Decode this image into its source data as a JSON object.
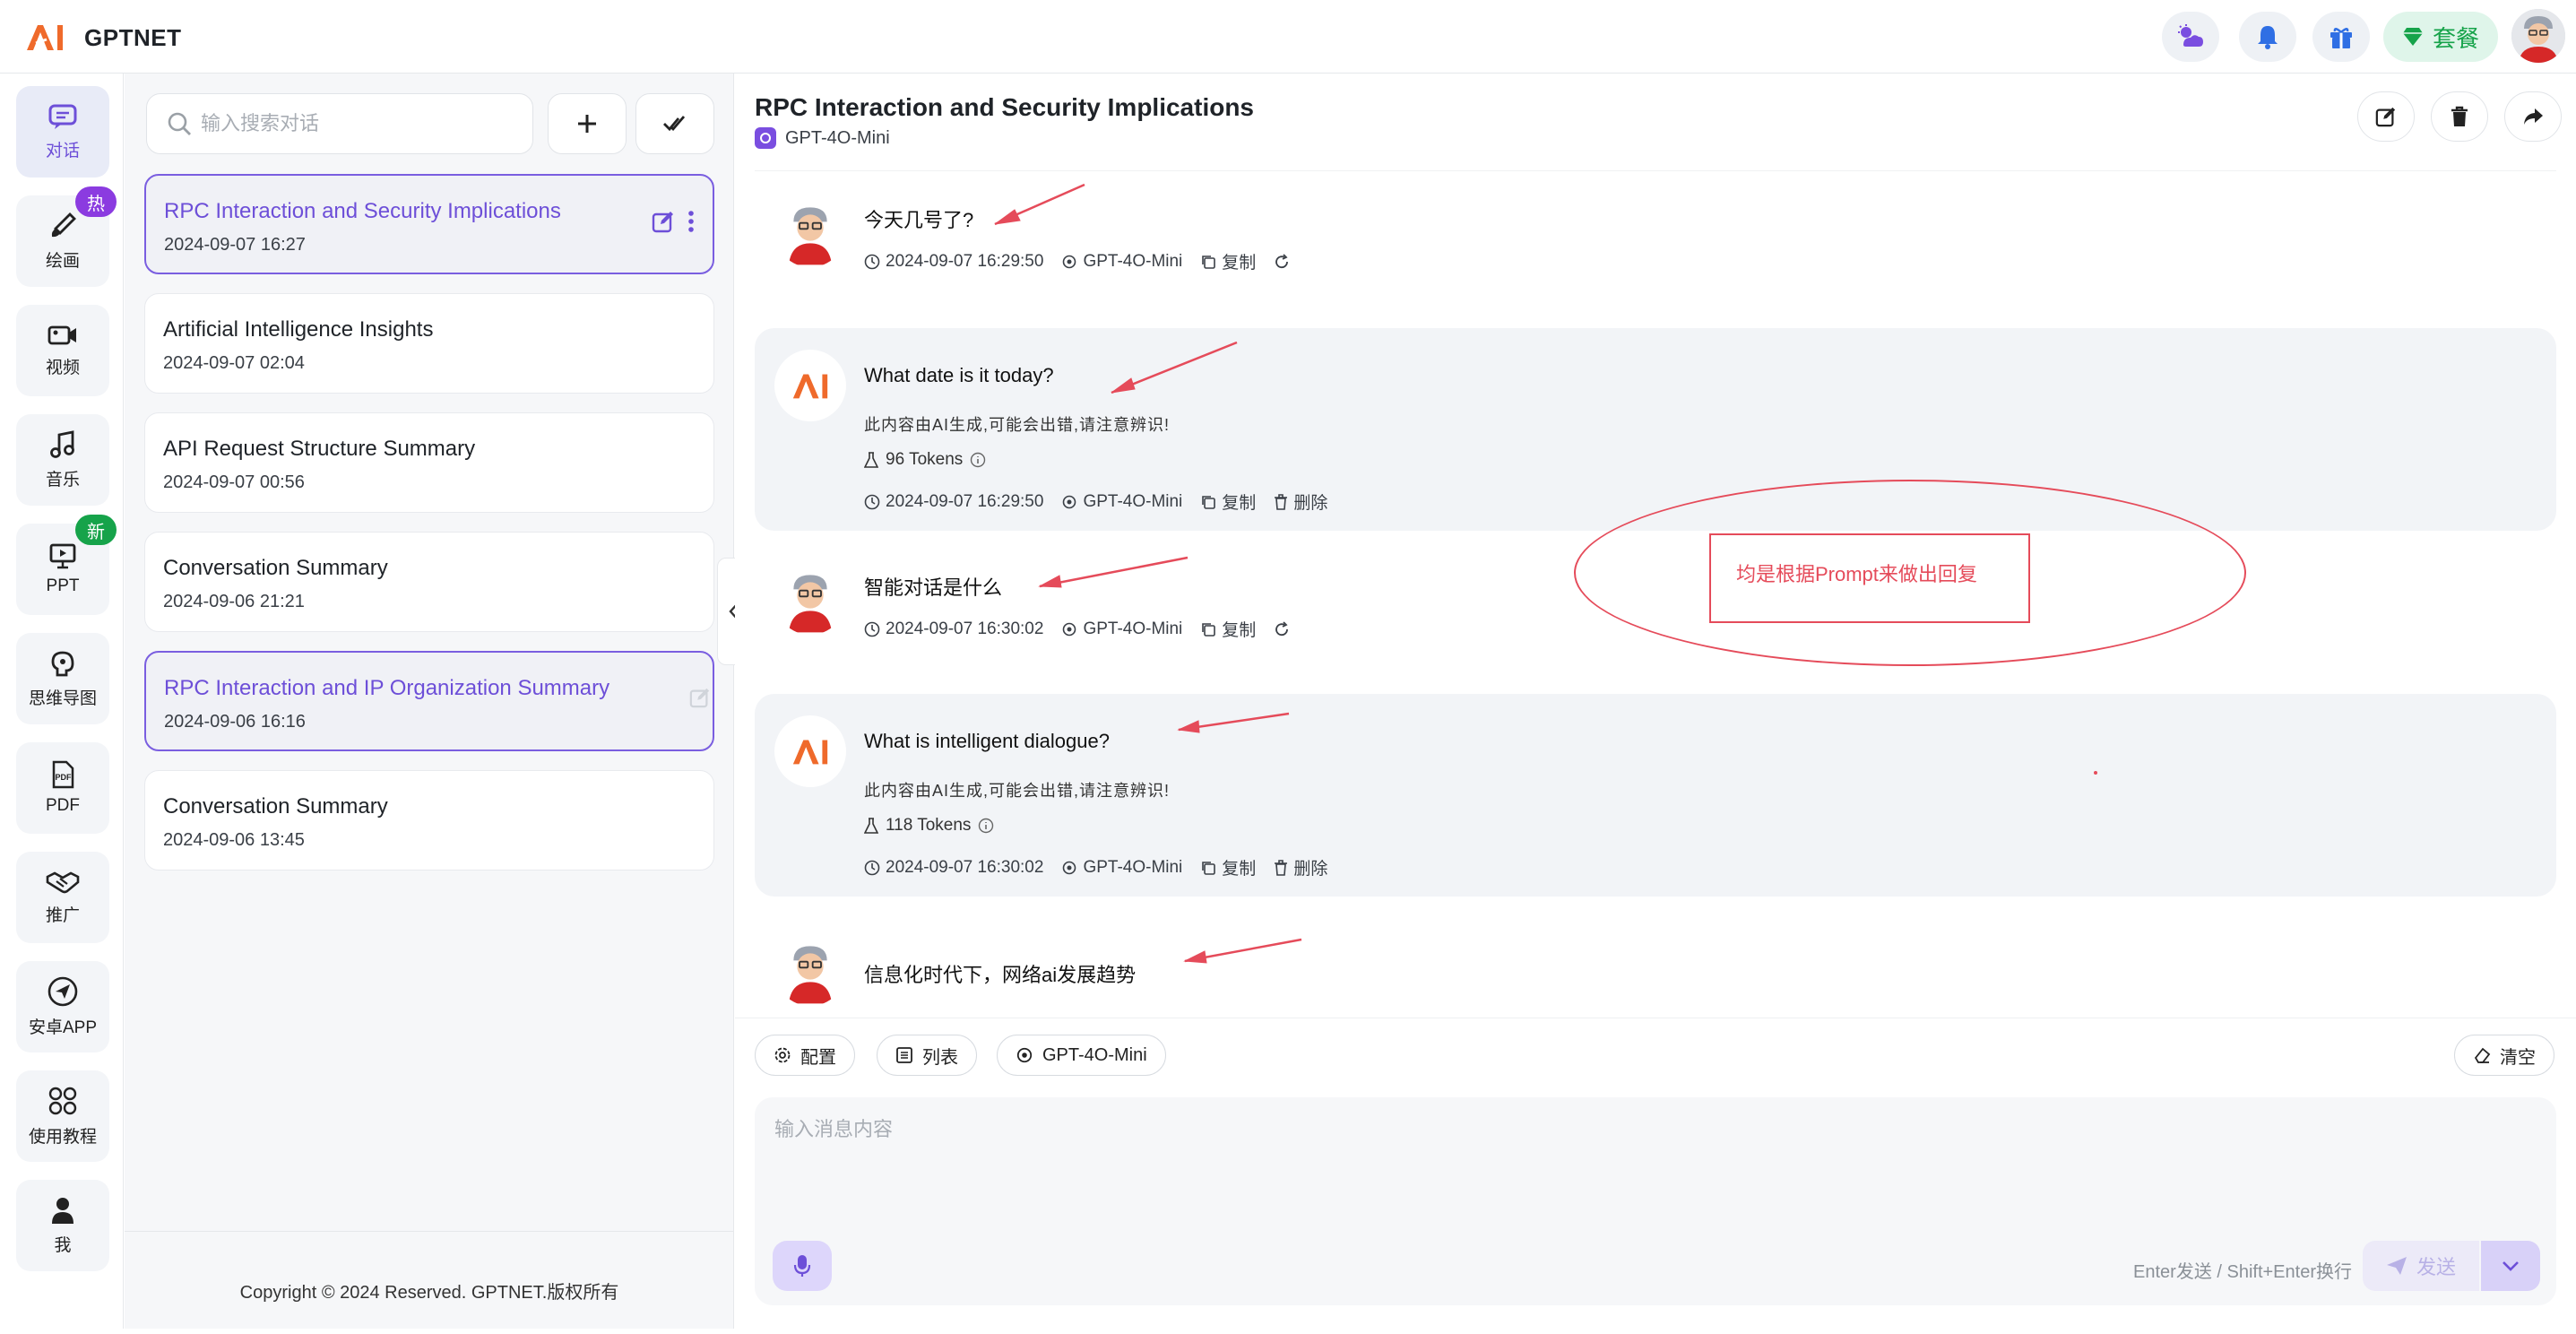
{
  "app": {
    "brand": "GPTNET"
  },
  "topbar": {
    "plan_label": "套餐"
  },
  "nav": [
    {
      "id": "chat",
      "label": "对话",
      "icon": "chat-icon",
      "active": true
    },
    {
      "id": "draw",
      "label": "绘画",
      "icon": "brush-icon",
      "badge": "热"
    },
    {
      "id": "video",
      "label": "视频",
      "icon": "video-icon"
    },
    {
      "id": "music",
      "label": "音乐",
      "icon": "music-note-icon"
    },
    {
      "id": "ppt",
      "label": "PPT",
      "icon": "presentation-icon",
      "badge": "新"
    },
    {
      "id": "mindmap",
      "label": "思维导图",
      "icon": "brain-icon"
    },
    {
      "id": "pdf",
      "label": "PDF",
      "icon": "pdf-icon"
    },
    {
      "id": "promo",
      "label": "推广",
      "icon": "handshake-icon"
    },
    {
      "id": "android",
      "label": "安卓APP",
      "icon": "send-icon"
    },
    {
      "id": "tutorial",
      "label": "使用教程",
      "icon": "grid-circles-icon"
    },
    {
      "id": "me",
      "label": "我",
      "icon": "user-icon"
    }
  ],
  "sidebar": {
    "search_placeholder": "输入搜索对话",
    "conversations": [
      {
        "title": "RPC Interaction and Security Implications",
        "time": "2024-09-07 16:27",
        "selected": true
      },
      {
        "title": "Artificial Intelligence Insights",
        "time": "2024-09-07 02:04"
      },
      {
        "title": "API Request Structure Summary",
        "time": "2024-09-07 00:56"
      },
      {
        "title": "Conversation Summary",
        "time": "2024-09-06 21:21"
      },
      {
        "title": "RPC Interaction and IP Organization Summary",
        "time": "2024-09-06 16:16",
        "selected": true
      },
      {
        "title": "Conversation Summary",
        "time": "2024-09-06 13:45"
      }
    ],
    "footer": "Copyright © 2024 Reserved. GPTNET.版权所有"
  },
  "chat": {
    "title": "RPC Interaction and Security Implications",
    "model": "GPT-4O-Mini",
    "messages": [
      {
        "role": "user",
        "text": "今天几号了?",
        "time": "2024-09-07 16:29:50",
        "model": "GPT-4O-Mini",
        "copy": "复制"
      },
      {
        "role": "ai",
        "text": "What date is it today?",
        "note": "此内容由AI生成,可能会出错,请注意辨识!",
        "tokens": "96 Tokens",
        "time": "2024-09-07 16:29:50",
        "model": "GPT-4O-Mini",
        "copy": "复制",
        "delete": "删除"
      },
      {
        "role": "user",
        "text": "智能对话是什么",
        "time": "2024-09-07 16:30:02",
        "model": "GPT-4O-Mini",
        "copy": "复制"
      },
      {
        "role": "ai",
        "text": "What is intelligent dialogue?",
        "note": "此内容由AI生成,可能会出错,请注意辨识!",
        "tokens": "118 Tokens",
        "time": "2024-09-07 16:30:02",
        "model": "GPT-4O-Mini",
        "copy": "复制",
        "delete": "删除"
      },
      {
        "role": "user",
        "text": "信息化时代下，网络ai发展趋势"
      }
    ],
    "annotation": "均是根据Prompt来做出回复"
  },
  "toolbar": {
    "config": "配置",
    "list": "列表",
    "model": "GPT-4O-Mini",
    "clear": "清空"
  },
  "composer": {
    "placeholder": "输入消息内容",
    "hint": "Enter发送 / Shift+Enter换行",
    "send": "发送"
  },
  "colors": {
    "accent": "#6d4fd8",
    "annotation": "#e54b5a",
    "hot_badge": "#8b3be0",
    "new_badge": "#16a34a"
  }
}
